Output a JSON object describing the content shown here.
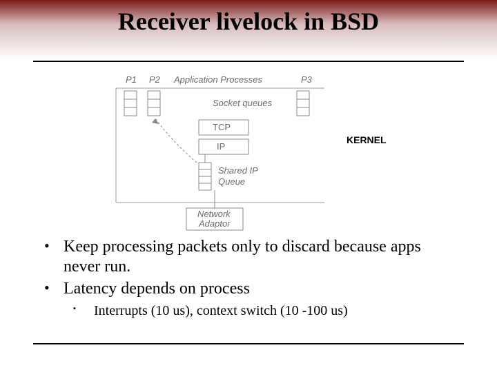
{
  "title": "Receiver livelock in BSD",
  "diagram": {
    "labels": {
      "p1": "P1",
      "p2": "P2",
      "appProc": "Application Processes",
      "p3": "P3",
      "socketQueues": "Socket queues",
      "tcp": "TCP",
      "ip": "IP",
      "sharedIp": "Shared IP",
      "queue": "Queue",
      "netAdaptor1": "Network",
      "netAdaptor2": "Adaptor",
      "kernel": "KERNEL"
    }
  },
  "bullets": {
    "items": [
      {
        "text": "Keep processing packets only to discard because apps never run."
      },
      {
        "text": "Latency depends on process"
      }
    ],
    "sub": "Interrupts (10 us), context switch (10 -100 us)"
  }
}
